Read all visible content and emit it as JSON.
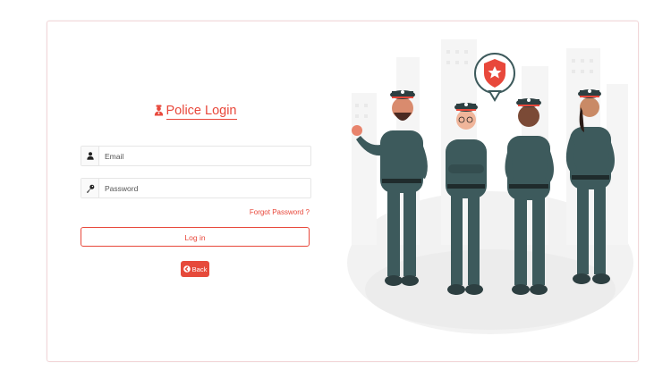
{
  "login": {
    "title": "Police Login",
    "email_placeholder": "Email",
    "password_placeholder": "Password",
    "forgot_label": "Forgot Password ?",
    "login_label": "Log in",
    "back_label": "Back"
  },
  "colors": {
    "accent": "#e8483b",
    "uniform": "#3d5a5c",
    "border": "#f2d6d8"
  },
  "icons": [
    "police-officer-icon",
    "user-icon",
    "key-icon",
    "arrow-left-circle-icon",
    "police-badge-icon"
  ]
}
